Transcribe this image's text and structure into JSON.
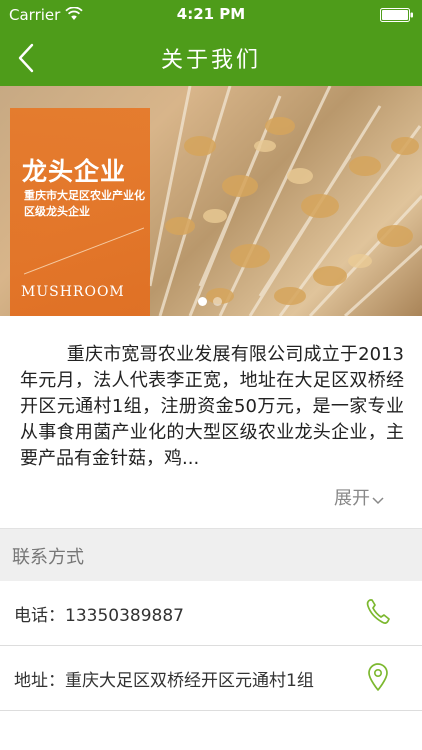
{
  "status_bar": {
    "carrier": "Carrier",
    "time": "4:21 PM"
  },
  "nav": {
    "title": "关于我们"
  },
  "banner": {
    "headline": "龙头企业",
    "subtitle": "重庆市大足区农业产业化区级龙头企业",
    "brand": "MUSHROOM",
    "page_count": 2,
    "active_page": 1
  },
  "intro": {
    "text": "重庆市宽哥农业发展有限公司成立于2013年元月，法人代表李正宽，地址在大足区双桥经开区元通村1组，注册资金50万元，是一家专业从事食用菌产业化的大型区级农业龙头企业，主要产品有金针菇，鸡...",
    "expand_label": "展开"
  },
  "contact": {
    "section_title": "联系方式",
    "phone_text": "电话：13350389887",
    "address_text": "地址：重庆大足区双桥经开区元通村1组"
  },
  "colors": {
    "header_green": "#4e9c1a",
    "icon_green": "#7cb82f",
    "banner_orange": "#e46f22"
  }
}
